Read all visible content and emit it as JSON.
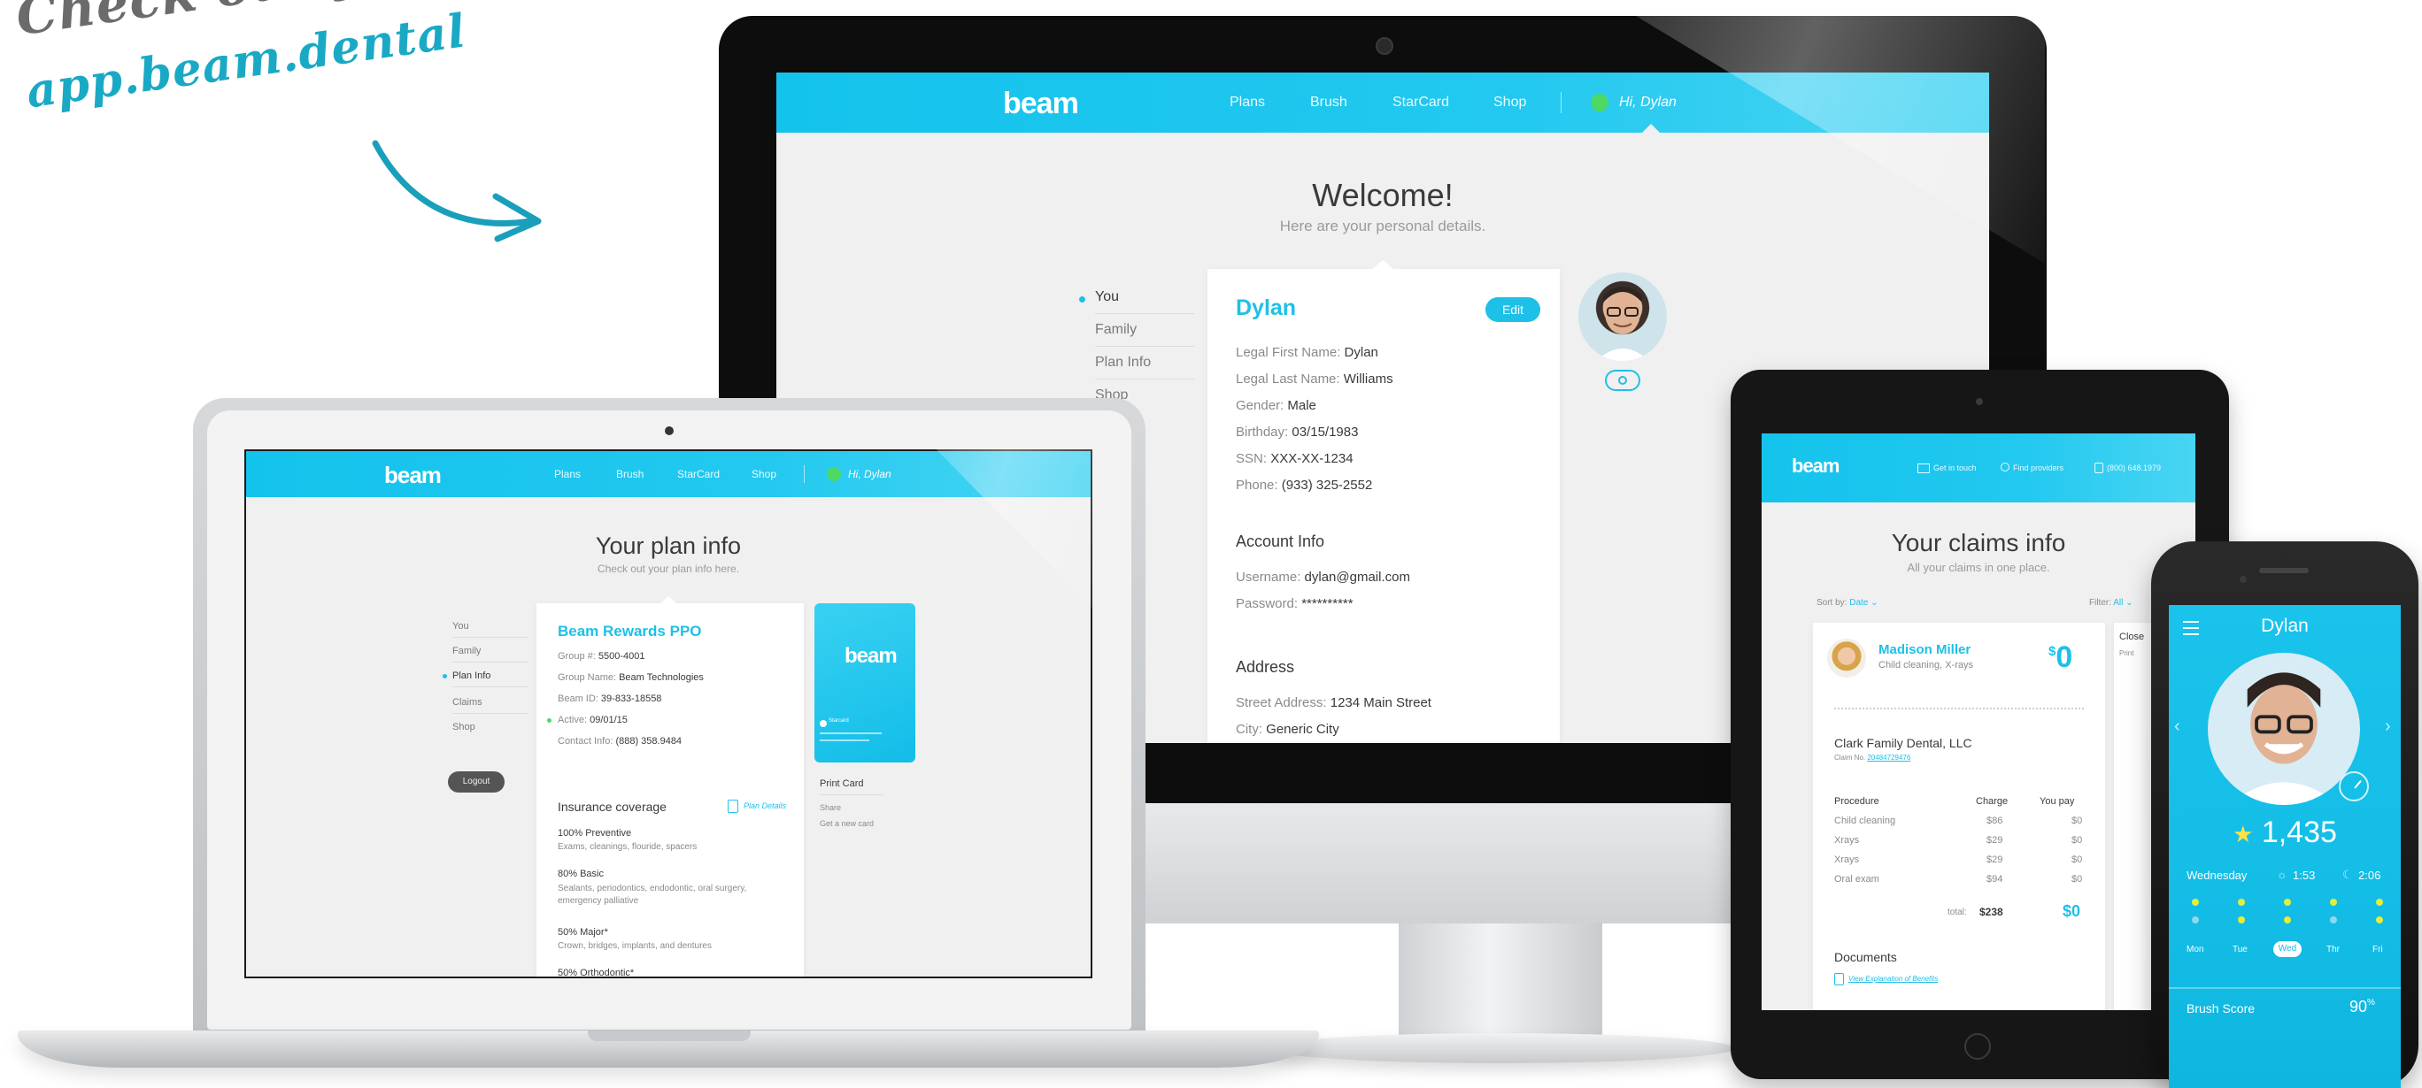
{
  "headline": {
    "line1": "Check out your app!",
    "line2": "app.beam.dental"
  },
  "brand": {
    "logo": "beam",
    "accent": "#1ec0e8",
    "green": "#4cd964"
  },
  "nav": {
    "plans": "Plans",
    "brush": "Brush",
    "starcard": "StarCard",
    "shop": "Shop",
    "greeting": "Hi, Dylan"
  },
  "monitor": {
    "title": "Welcome!",
    "subtitle": "Here are your personal details.",
    "sidebar": [
      "You",
      "Family",
      "Plan Info",
      "Shop"
    ],
    "name": "Dylan",
    "edit": "Edit",
    "personal": [
      {
        "label": "Legal First Name:",
        "value": "Dylan"
      },
      {
        "label": "Legal Last Name:",
        "value": "Williams"
      },
      {
        "label": "Gender:",
        "value": "Male"
      },
      {
        "label": "Birthday:",
        "value": "03/15/1983"
      },
      {
        "label": "SSN:",
        "value": "XXX-XX-1234"
      },
      {
        "label": "Phone:",
        "value": "(933) 325-2552"
      }
    ],
    "account_heading": "Account Info",
    "account": [
      {
        "label": "Username:",
        "value": "dylan@gmail.com"
      },
      {
        "label": "Password:",
        "value": "**********"
      }
    ],
    "address_heading": "Address",
    "address": [
      {
        "label": "Street Address:",
        "value": "1234 Main Street"
      },
      {
        "label": "City:",
        "value": "Generic City"
      }
    ]
  },
  "laptop": {
    "title": "Your plan info",
    "subtitle": "Check out your plan info here.",
    "sidebar": [
      "You",
      "Family",
      "Plan Info",
      "Claims",
      "Shop"
    ],
    "logout": "Logout",
    "plan_name": "Beam Rewards PPO",
    "details": [
      {
        "label": "Group #:",
        "value": "5500-4001"
      },
      {
        "label": "Group Name:",
        "value": "Beam Technologies"
      },
      {
        "label": "Beam ID:",
        "value": "39-833-18558"
      },
      {
        "label": "Active:",
        "value": "09/01/15"
      },
      {
        "label": "Contact Info:",
        "value": "(888) 358.9484"
      }
    ],
    "coverage_heading": "Insurance coverage",
    "plan_details": "Plan Details",
    "coverage": [
      {
        "title": "100% Preventive",
        "desc": "Exams, cleanings, flouride, spacers"
      },
      {
        "title": "80% Basic",
        "desc": "Sealants, periodontics, endodontic, oral surgery, emergency palliative"
      },
      {
        "title": "50% Major*",
        "desc": "Crown, bridges, implants, and dentures"
      },
      {
        "title": "50% Orthodontic*",
        "desc": ""
      }
    ],
    "card_logo": "beam",
    "card_label": "Starcard",
    "print_card": "Print Card",
    "share": "Share",
    "get_new_card": "Get a new card"
  },
  "tablet": {
    "top_links": [
      "Get in touch",
      "Find providers",
      "(800) 648.1979"
    ],
    "title": "Your claims info",
    "subtitle": "All your claims in one place.",
    "sort_label": "Sort by:",
    "sort_value": "Date",
    "filter_label": "Filter:",
    "filter_value": "All",
    "patient": "Madison Miller",
    "patient_desc": "Child cleaning, X-rays",
    "amount": "0",
    "currency": "$",
    "provider": "Clark Family Dental, LLC",
    "claim_label": "Claim No.",
    "claim_no": "20484729476",
    "columns": [
      "Procedure",
      "Charge",
      "You pay"
    ],
    "rows": [
      {
        "procedure": "Child cleaning",
        "charge": "$86",
        "pay": "$0"
      },
      {
        "procedure": "Xrays",
        "charge": "$29",
        "pay": "$0"
      },
      {
        "procedure": "Xrays",
        "charge": "$29",
        "pay": "$0"
      },
      {
        "procedure": "Oral exam",
        "charge": "$94",
        "pay": "$0"
      }
    ],
    "total_label": "total:",
    "total_charge": "$238",
    "total_pay": "$0",
    "documents_heading": "Documents",
    "document_link": "View Explanation of Benefits",
    "side_peek": "Close",
    "side_peek2": "Print"
  },
  "phone": {
    "title": "Dylan",
    "score": "1,435",
    "day": "Wednesday",
    "morning": "1:53",
    "night": "2:06",
    "weekdays": [
      "Mon",
      "Tue",
      "Wed",
      "Thr",
      "Fri"
    ],
    "selected_day": "Wed",
    "brush_score_label": "Brush Score",
    "brush_score": "90",
    "brush_score_unit": "%"
  }
}
